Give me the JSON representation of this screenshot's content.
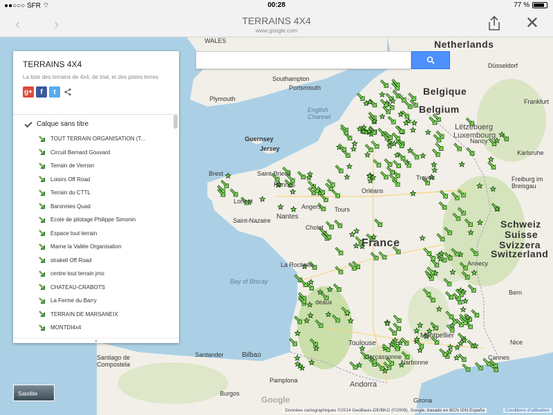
{
  "status_bar": {
    "carrier": "SFR",
    "time": "00:28",
    "battery": "77 %"
  },
  "browser": {
    "title": "TERRAINS 4X4",
    "url": "www.google.com",
    "back_icon": "chevron-left-icon",
    "forward_icon": "chevron-right-icon",
    "share_icon": "share-icon",
    "close_icon": "close-icon"
  },
  "search": {
    "placeholder": "",
    "button_icon": "search-icon"
  },
  "panel": {
    "title": "TERRAINS 4X4",
    "description": "La liste des terrains de 4x4, de trial, et des pistes terres",
    "layer_name": "Calque sans titre",
    "items": [
      "TOUT TERRAIN ORGANISATION (T...",
      "Circuit Bernard Gouvard",
      "Terrain de Vernon",
      "Loisirs Off Road",
      "Terrain du CTTL",
      "Baronnies Quad",
      "Ecole de pilotage Philippe Simonin",
      "Espace tout terrain",
      "Marne la Vallée Organisation",
      "strakell Off Road",
      "centre tout terrain jmo",
      "CHATEAU-CRABOTS",
      "La Ferme du Barry",
      "TERRAIN DE MARSANEIX",
      "MONTDI4x4"
    ]
  },
  "map": {
    "labels": {
      "france": "France",
      "netherlands": "Netherlands",
      "belgique": "Belgique",
      "belgium": "Belgium",
      "luxembourg": "Luxembourg",
      "letzebuerg": "Lëtzebuerg",
      "schweiz": "Schweiz",
      "suisse": "Suisse",
      "svizzera": "Svizzera",
      "switzerland": "Switzerland",
      "andorra": "Andorra",
      "wales": "WALES",
      "english_channel": "English Channel",
      "bay_of_biscay": "Bay of Biscay",
      "guernsey": "Guernsey",
      "jersey": "Jersey",
      "dusseldorf": "Düsseldorf",
      "frankfurt": "Frankfurt",
      "karlsruhe": "Karlsruhe",
      "freiburg": "Freiburg im Breisgau",
      "plymouth": "Plymouth",
      "southampton": "Southampton",
      "portsmouth": "Portsmouth",
      "brest": "Brest",
      "rennes": "Rennes",
      "nantes": "Nantes",
      "angers": "Angers",
      "tours": "Tours",
      "orleans": "Orléans",
      "troyes": "Troyes",
      "nancy": "Nancy",
      "cholet": "Cholet",
      "saint_nazaire": "Saint-Nazaire",
      "la_rochelle": "La Rochelle",
      "bordeaux": "deaux",
      "toulouse": "Toulouse",
      "montpellier": "Montpellier",
      "narbonne": "Narbonne",
      "carcassonne": "Carcassonne",
      "cannes": "Cannes",
      "nice": "Nice",
      "annecy": "Annecy",
      "bilbao": "Bilbao",
      "santander": "Santander",
      "santiago": "Santiago de Compostela",
      "pamplona": "Pamplona",
      "burgos": "Burgos",
      "girona": "Girona",
      "bern": "Bern",
      "saint_brieuc": "Saint-Brieuc",
      "lorient": "Lorient"
    }
  },
  "satellite_label": "Satellite",
  "google_logo": "Google",
  "footer": {
    "credits": "Données cartographiques ©2014 GeoBasis-DE/BKG (©2009), Google, basado en BCN IGN España",
    "terms": "Conditions d'utilisation"
  },
  "colors": {
    "land": "#f2efe9",
    "water": "#abd0e6",
    "forest": "#cadfaa",
    "marker": "#4caf50",
    "search_button": "#4d90fe"
  }
}
